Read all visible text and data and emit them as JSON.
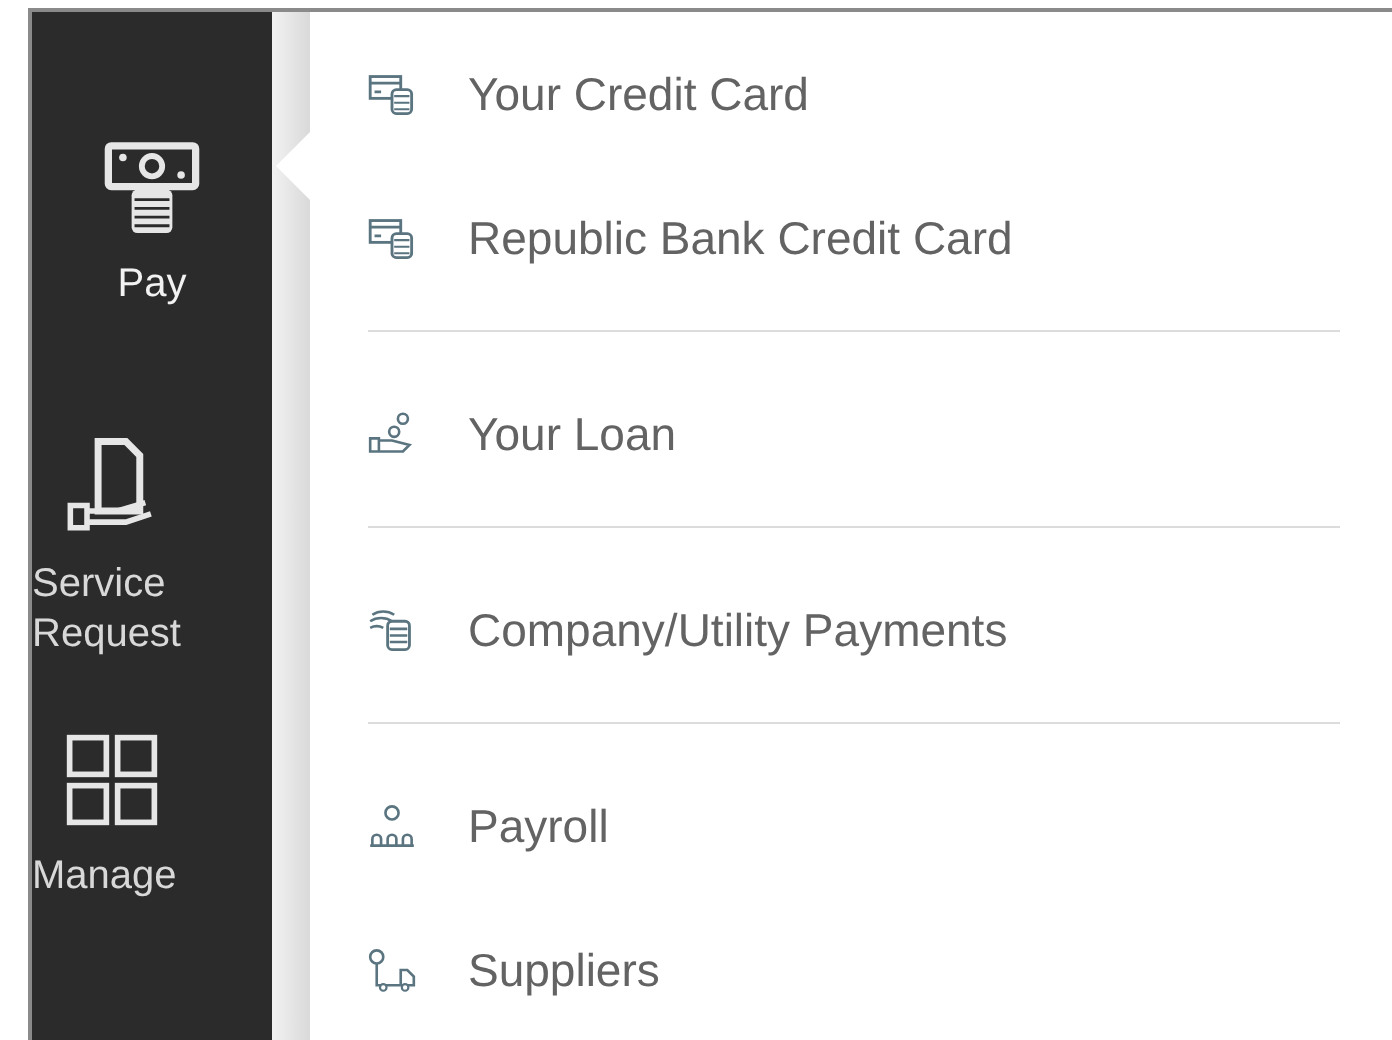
{
  "sidebar": {
    "items": [
      {
        "label": "Pay",
        "kind": "pay",
        "selected": true
      },
      {
        "label": "Service\nRequest",
        "kind": "service",
        "selected": false
      },
      {
        "label": "Manage",
        "kind": "manage",
        "selected": false
      }
    ]
  },
  "menu": {
    "sections": [
      {
        "items": [
          {
            "label": "Your Credit Card",
            "kind": "card"
          },
          {
            "label": "Republic Bank Credit Card",
            "kind": "card"
          }
        ]
      },
      {
        "items": [
          {
            "label": "Your Loan",
            "kind": "loan"
          }
        ]
      },
      {
        "items": [
          {
            "label": "Company/Utility Payments",
            "kind": "utility"
          }
        ]
      },
      {
        "items": [
          {
            "label": "Payroll",
            "kind": "payroll"
          },
          {
            "label": "Suppliers",
            "kind": "suppliers"
          }
        ]
      }
    ]
  }
}
